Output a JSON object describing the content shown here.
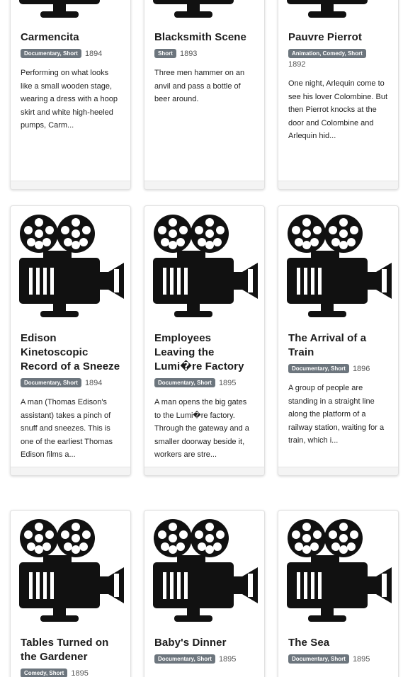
{
  "movies": [
    {
      "title": "Carmencita",
      "genres": "Documentary, Short",
      "year": "1894",
      "description": "Performing on what looks like a small wooden stage, wearing a dress with a hoop skirt and white high-heeled pumps, Carm..."
    },
    {
      "title": "Blacksmith Scene",
      "genres": "Short",
      "year": "1893",
      "description": "Three men hammer on an anvil and pass a bottle of beer around."
    },
    {
      "title": "Pauvre Pierrot",
      "genres": "Animation, Comedy, Short",
      "year": "1892",
      "description": "One night, Arlequin come to see his lover Colombine. But then Pierrot knocks at the door and Colombine and Arlequin hid..."
    },
    {
      "title": "Edison Kinetoscopic Record of a Sneeze",
      "genres": "Documentary, Short",
      "year": "1894",
      "description": "A man (Thomas Edison's assistant) takes a pinch of snuff and sneezes. This is one of the earliest Thomas Edison films a..."
    },
    {
      "title": "Employees Leaving the Lumi�re Factory",
      "genres": "Documentary, Short",
      "year": "1895",
      "description": "A man opens the big gates to the Lumi�re factory. Through the gateway and a smaller doorway beside it, workers are stre..."
    },
    {
      "title": "The Arrival of a Train",
      "genres": "Documentary, Short",
      "year": "1896",
      "description": "A group of people are standing in a straight line along the platform of a railway station, waiting for a train, which i..."
    },
    {
      "title": "Tables Turned on the Gardener",
      "genres": "Comedy, Short",
      "year": "1895",
      "description": ""
    },
    {
      "title": "Baby's Dinner",
      "genres": "Documentary, Short",
      "year": "1895",
      "description": ""
    },
    {
      "title": "The Sea",
      "genres": "Documentary, Short",
      "year": "1895",
      "description": ""
    }
  ],
  "poster_icon": "movie-camera-icon"
}
